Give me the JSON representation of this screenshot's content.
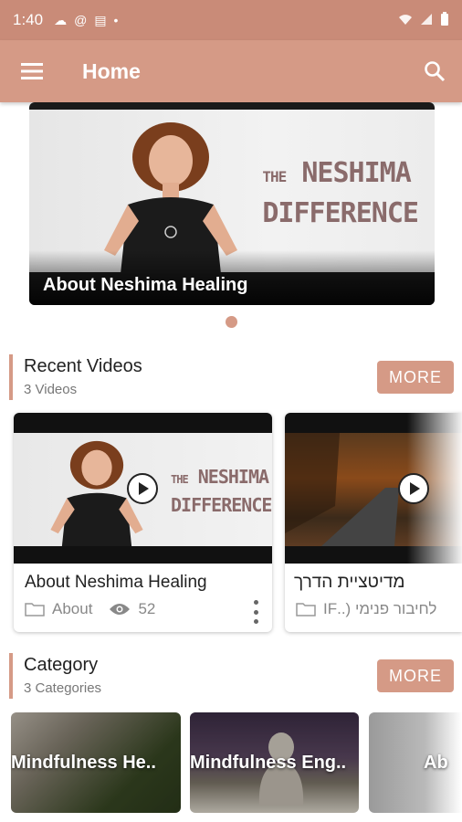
{
  "status_bar": {
    "time": "1:40",
    "icons": [
      "cloud-icon",
      "at-icon",
      "card-icon",
      "dot-icon"
    ],
    "right_icons": [
      "wifi-icon",
      "signal-icon",
      "battery-icon"
    ]
  },
  "app_bar": {
    "title": "Home"
  },
  "hero": {
    "brand_line1_small": "THE",
    "brand_line1": "NESHIMA",
    "brand_line2": "DIFFERENCE",
    "caption": "About Neshima Healing"
  },
  "recent": {
    "title": "Recent Videos",
    "subtitle": "3 Videos",
    "more_label": "MORE",
    "videos": [
      {
        "title": "About Neshima Healing",
        "category": "About",
        "views": "52",
        "brand_small": "THE",
        "brand1": "NESHIMA",
        "brand2": "DIFFERENCE"
      },
      {
        "title": "מדיטציית הדרך",
        "category": "לחיבור פנימי (..IF"
      }
    ]
  },
  "category": {
    "title": "Category",
    "subtitle": "3 Categories",
    "more_label": "MORE",
    "items": [
      {
        "label": "Mindfulness He.."
      },
      {
        "label": "Mindfulness Eng.."
      },
      {
        "label": "Ab"
      }
    ]
  },
  "colors": {
    "accent": "#d59a86",
    "status": "#c98b78"
  }
}
